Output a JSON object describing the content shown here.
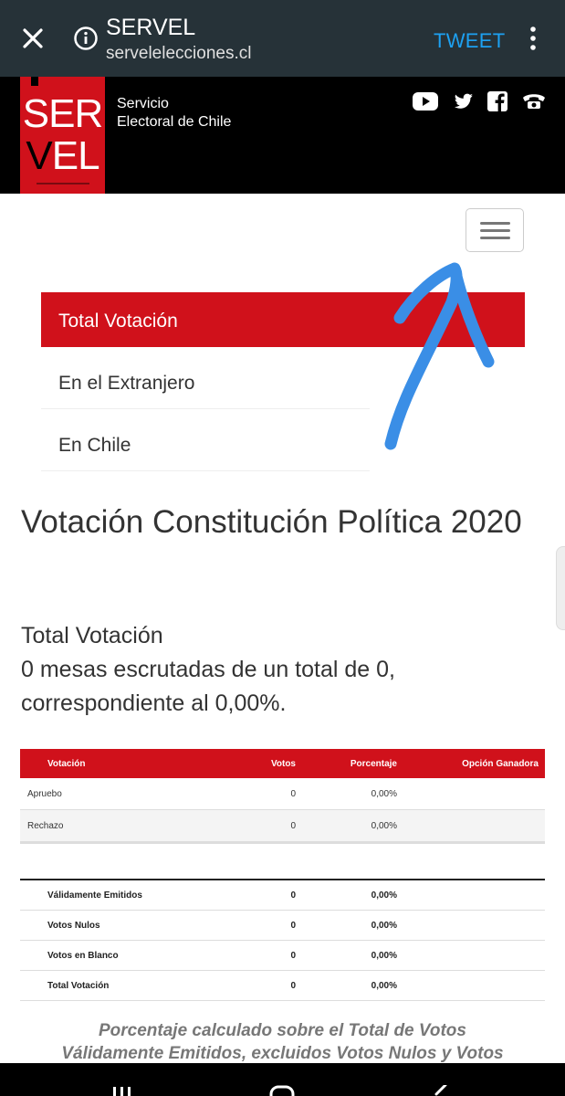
{
  "browser": {
    "title": "SERVEL",
    "url": "servelelecciones.cl",
    "tweet_label": "TWEET",
    "icons": [
      "close-icon",
      "info-icon",
      "more-vert-icon"
    ]
  },
  "header": {
    "logo_line1": "SER",
    "logo_line2_v": "V",
    "logo_line2_rest": "EL",
    "org_line1": "Servicio",
    "org_line2": "Electoral de Chile",
    "social_icons": [
      "youtube-icon",
      "twitter-icon",
      "facebook-icon",
      "phone-icon"
    ],
    "brand_color": "#d0111b"
  },
  "nav": {
    "items": [
      "Total Votación",
      "En el Extranjero",
      "En Chile"
    ],
    "active_index": 0
  },
  "main": {
    "title": "Votación Constitución Política 2020",
    "section_title": "Total Votación",
    "summary_line1": "0 mesas escrutadas de un total de 0,",
    "summary_line2": "correspondiente al 0,00%."
  },
  "results_table": {
    "headers": [
      "Votación",
      "Votos",
      "Porcentaje",
      "Opción Ganadora"
    ],
    "rows": [
      {
        "option": "Apruebo",
        "votes": "0",
        "percent": "0,00%",
        "winner": ""
      },
      {
        "option": "Rechazo",
        "votes": "0",
        "percent": "0,00%",
        "winner": ""
      }
    ]
  },
  "totals_table": {
    "rows": [
      {
        "label": "Válidamente Emitidos",
        "votes": "0",
        "percent": "0,00%"
      },
      {
        "label": "Votos Nulos",
        "votes": "0",
        "percent": "0,00%"
      },
      {
        "label": "Votos en Blanco",
        "votes": "0",
        "percent": "0,00%"
      },
      {
        "label": "Total Votación",
        "votes": "0",
        "percent": "0,00%"
      }
    ]
  },
  "footnote": {
    "line1": "Porcentaje calculado sobre el Total de Votos",
    "line2": "Válidamente Emitidos, excluidos Votos Nulos y Votos"
  },
  "annotation_color": "#3a8ee6"
}
